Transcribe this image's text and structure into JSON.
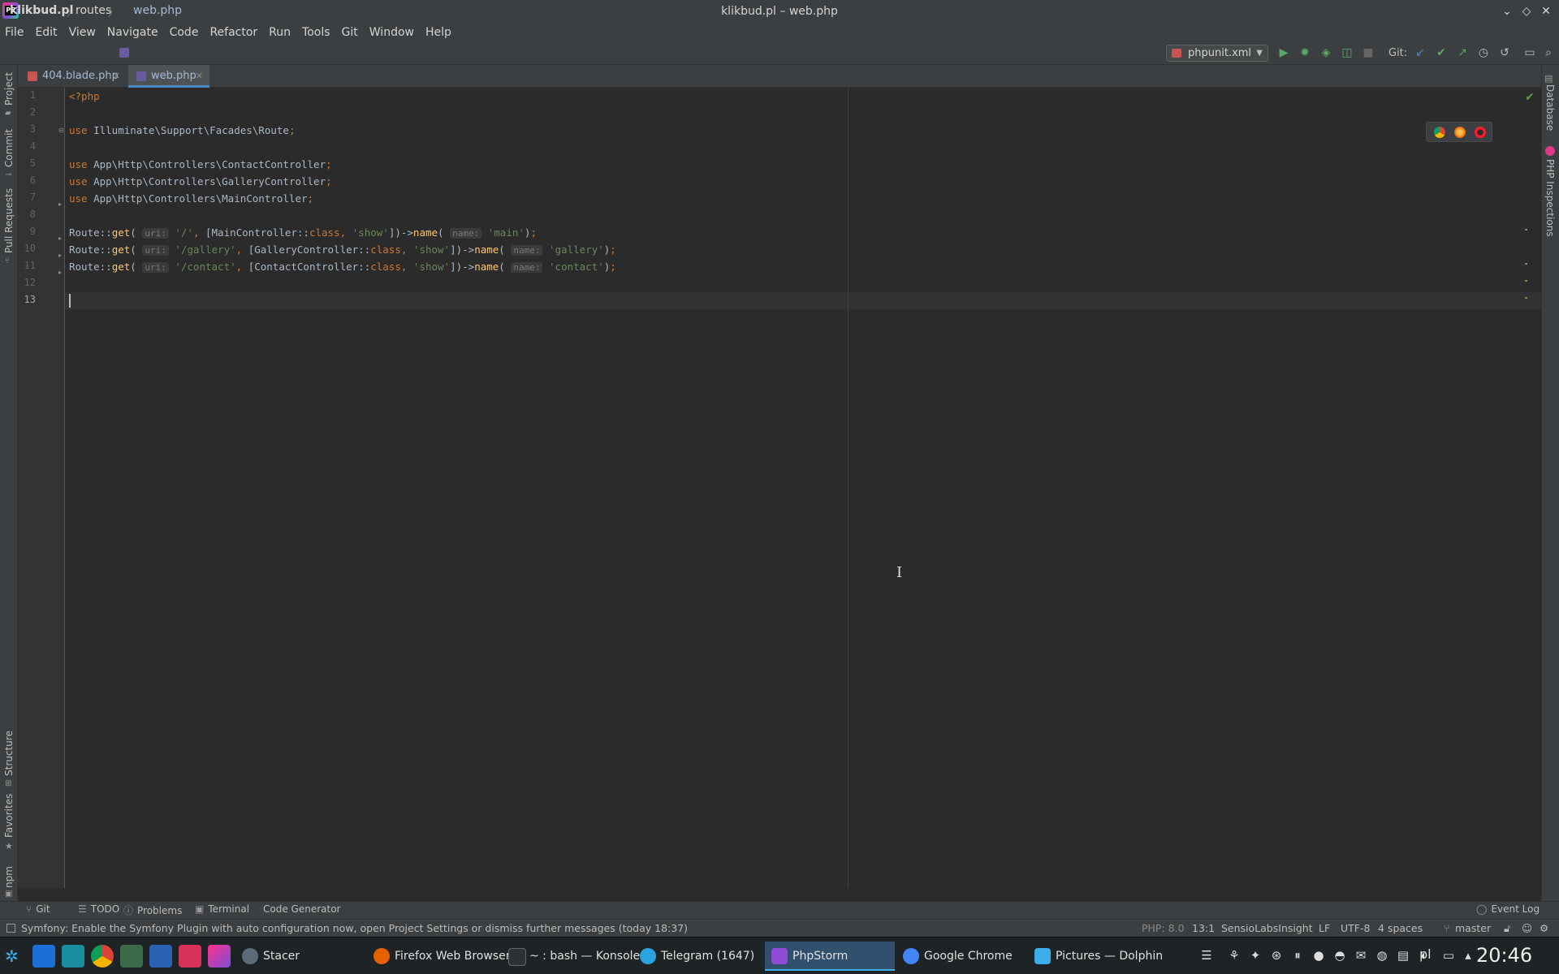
{
  "window": {
    "title": "klikbud.pl – web.php"
  },
  "menu": [
    "File",
    "Edit",
    "View",
    "Navigate",
    "Code",
    "Refactor",
    "Run",
    "Tools",
    "Git",
    "Window",
    "Help"
  ],
  "breadcrumbs": [
    "klikbud.pl",
    "routes",
    "web.php"
  ],
  "run_config": "phpunit.xml",
  "git_label": "Git:",
  "tabs": [
    {
      "label": "404.blade.php",
      "active": false
    },
    {
      "label": "web.php",
      "active": true
    }
  ],
  "left_tools": [
    "Project",
    "Commit",
    "Pull Requests",
    "Structure",
    "Favorites",
    "npm"
  ],
  "right_tools": [
    "Database",
    "PHP Inspections"
  ],
  "editor": {
    "line_numbers": [
      "1",
      "2",
      "3",
      "4",
      "5",
      "6",
      "7",
      "8",
      "9",
      "10",
      "11",
      "12",
      "13"
    ],
    "current_line": "13",
    "param_hints": {
      "uri": "uri:",
      "name": "name:"
    },
    "lines": [
      "<?php",
      "",
      "use Illuminate\\Support\\Facades\\Route;",
      "",
      "use App\\Http\\Controllers\\ContactController;",
      "use App\\Http\\Controllers\\GalleryController;",
      "use App\\Http\\Controllers\\MainController;",
      "",
      "Route::get(uri: '/', [MainController::class, 'show'])->name(name: 'main');",
      "Route::get(uri: '/gallery', [GalleryController::class, 'show'])->name(name: 'gallery');",
      "Route::get(uri: '/contact', [ContactController::class, 'show'])->name(name: 'contact');",
      "",
      ""
    ],
    "tokens": {
      "php_open": "<?php",
      "use": "use",
      "facade": "Illuminate\\Support\\Facades\\Route",
      "ns": "App\\Http\\Controllers\\",
      "contact_ctrl": "ContactController",
      "gallery_ctrl": "GalleryController",
      "main_ctrl": "MainController",
      "route_get": "Route::",
      "get": "get",
      "class_kw": "class",
      "show": "'show'",
      "name_fn": "name",
      "r9_uri": "'/'",
      "r9_ctrl": "MainController::",
      "r9_name": "'main'",
      "r10_uri": "'/gallery'",
      "r10_ctrl": "GalleryController::",
      "r10_name": "'gallery'",
      "r11_uri": "'/contact'",
      "r11_ctrl": "ContactController::",
      "r11_name": "'contact'"
    }
  },
  "bottom_tools": [
    "Git",
    "TODO",
    "Problems",
    "Terminal",
    "Code Generator"
  ],
  "event_log": "Event Log",
  "status": {
    "message": "Symfony: Enable the Symfony Plugin with auto configuration now, open Project Settings or dismiss further messages (today 18:37)",
    "php_version": "PHP: 8.0",
    "position": "13:1",
    "insight": "SensioLabsInsight",
    "line_sep": "LF",
    "encoding": "UTF-8",
    "indent": "4 spaces",
    "branch": "master"
  },
  "taskbar": {
    "tasks": [
      {
        "label": "Stacer",
        "color": "#5a6b7a"
      },
      {
        "label": "Firefox Web Browser",
        "color": "#e66000"
      },
      {
        "label": "~ : bash — Konsole",
        "color": "#2d3136"
      },
      {
        "label": "Telegram (1647)",
        "color": "#2aa3de"
      },
      {
        "label": "PhpStorm",
        "color": "#8f4bd6"
      },
      {
        "label": "Google Chrome",
        "color": "#4285f4"
      },
      {
        "label": "Pictures — Dolphin",
        "color": "#3daee9"
      }
    ],
    "active_task": "PhpStorm",
    "keyboard_layout": "pl",
    "clock": "20:46"
  }
}
